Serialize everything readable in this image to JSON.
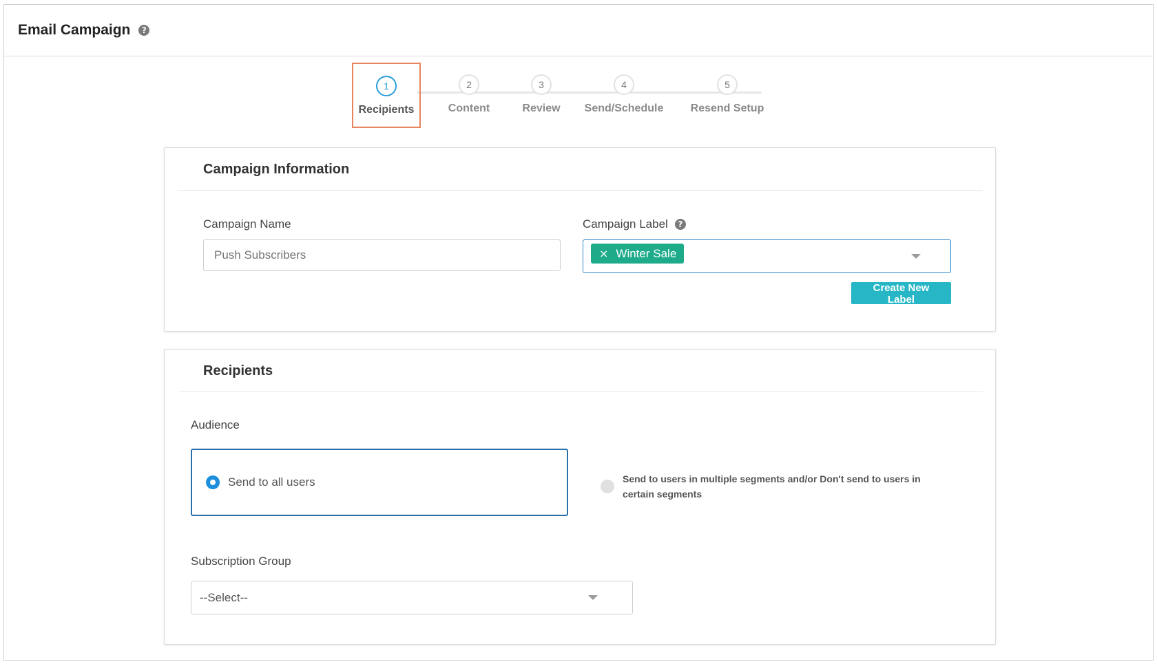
{
  "header": {
    "title": "Email Campaign",
    "help_glyph": "?"
  },
  "stepper": {
    "steps": [
      {
        "number": "1",
        "label": "Recipients",
        "active": true
      },
      {
        "number": "2",
        "label": "Content",
        "active": false
      },
      {
        "number": "3",
        "label": "Review",
        "active": false
      },
      {
        "number": "4",
        "label": "Send/Schedule",
        "active": false
      },
      {
        "number": "5",
        "label": "Resend Setup",
        "active": false
      }
    ]
  },
  "campaign_info": {
    "title": "Campaign Information",
    "name_label": "Campaign Name",
    "name_placeholder": "Push Subscribers",
    "label_label": "Campaign Label",
    "label_help_glyph": "?",
    "selected_tag": "Winter Sale",
    "tag_remove_glyph": "×",
    "create_button": "Create New Label"
  },
  "recipients": {
    "title": "Recipients",
    "audience_label": "Audience",
    "option_all": "Send to all users",
    "option_segments": "Send to users in multiple segments and/or Don't send to users in certain segments",
    "selected_option": "all",
    "subscription_label": "Subscription Group",
    "subscription_value": "--Select--"
  },
  "colors": {
    "active_step_border": "#e8845e",
    "active_step_circle": "#2a9ed8",
    "tag_bg": "#1dab8a",
    "create_button_bg": "#26b6c6",
    "radio_selected": "#1e8fdc",
    "audience_box_border": "#2a6fa8"
  }
}
